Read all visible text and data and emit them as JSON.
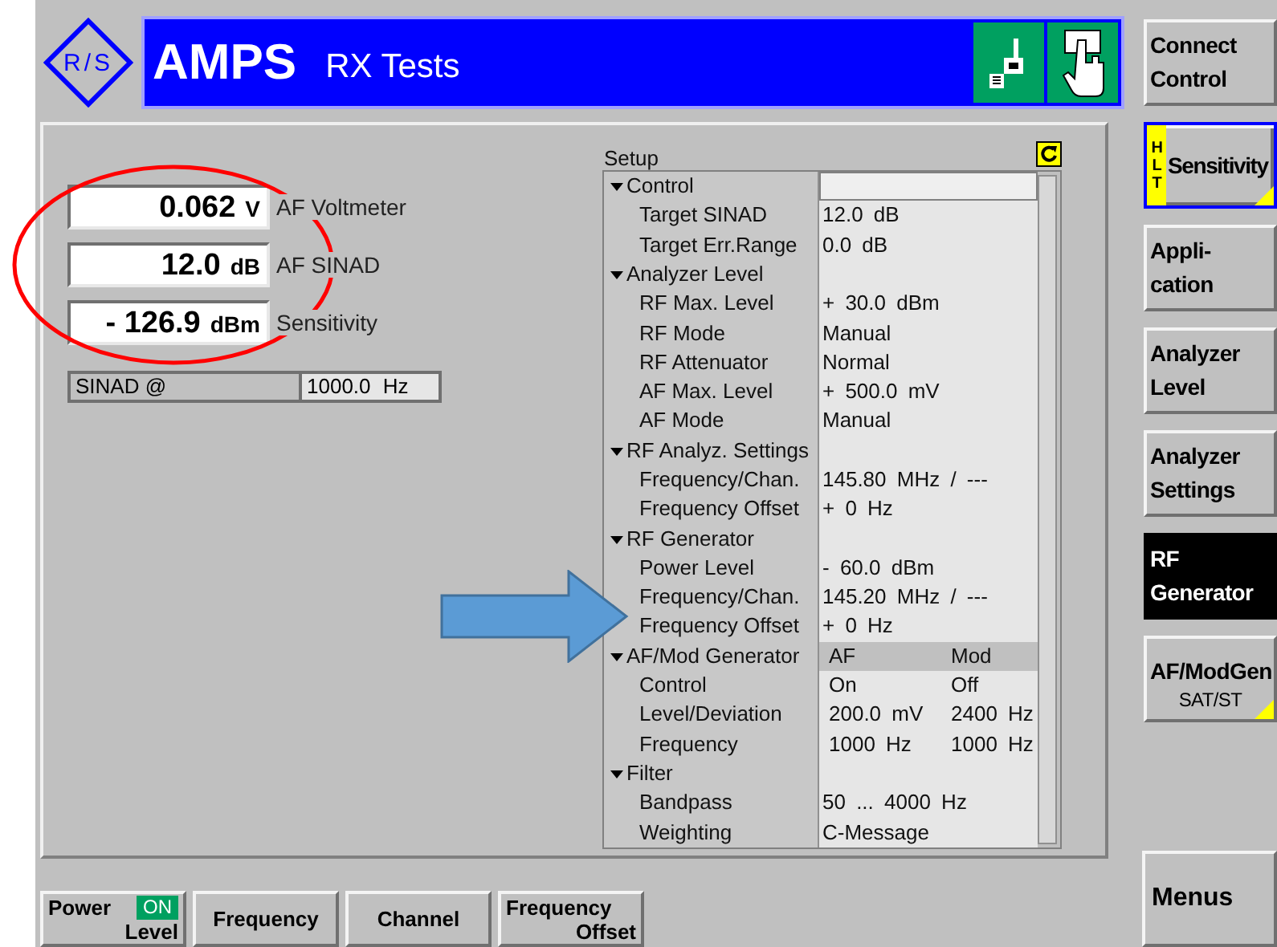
{
  "header": {
    "logo": "R/S",
    "title": "AMPS",
    "subtitle": "RX Tests"
  },
  "measurements": [
    {
      "value": "0.062",
      "unit": "V",
      "label": "AF Voltmeter"
    },
    {
      "value": "12.0",
      "unit": "dB",
      "label": "AF SINAD"
    },
    {
      "value": "- 126.9",
      "unit": "dBm",
      "label": "Sensitivity"
    }
  ],
  "sinad_at": {
    "label": "SINAD @",
    "value": "1000.0 Hz"
  },
  "setup": {
    "title": "Setup",
    "groups": [
      {
        "label": "Control",
        "expanded": true,
        "selected": true,
        "children": [
          {
            "label": "Target SINAD",
            "values": [
              "12.0 dB"
            ]
          },
          {
            "label": "Target Err.Range",
            "values": [
              "0.0 dB"
            ]
          }
        ]
      },
      {
        "label": "Analyzer Level",
        "expanded": true,
        "selected": false,
        "children": [
          {
            "label": "RF Max. Level",
            "values": [
              "+ 30.0 dBm"
            ]
          },
          {
            "label": "RF Mode",
            "values": [
              "Manual"
            ]
          },
          {
            "label": "RF Attenuator",
            "values": [
              "Normal"
            ]
          },
          {
            "label": "AF Max. Level",
            "values": [
              "+ 500.0 mV"
            ]
          },
          {
            "label": "AF Mode",
            "values": [
              "Manual"
            ]
          }
        ]
      },
      {
        "label": "RF Analyz. Settings",
        "expanded": true,
        "selected": false,
        "children": [
          {
            "label": "Frequency/Chan.",
            "values": [
              "145.80 MHz / ---"
            ]
          },
          {
            "label": "Frequency Offset",
            "values": [
              "+ 0 Hz"
            ]
          }
        ]
      },
      {
        "label": "RF Generator",
        "expanded": true,
        "selected": false,
        "children": [
          {
            "label": "Power Level",
            "values": [
              "- 60.0 dBm"
            ]
          },
          {
            "label": "Frequency/Chan.",
            "values": [
              "145.20 MHz / ---"
            ]
          },
          {
            "label": "Frequency Offset",
            "values": [
              "+ 0 Hz"
            ]
          }
        ]
      },
      {
        "label": "AF/Mod Generator",
        "expanded": true,
        "selected": false,
        "header_values": [
          "AF",
          "Mod"
        ],
        "children": [
          {
            "label": "Control",
            "values": [
              "On",
              "Off"
            ]
          },
          {
            "label": "Level/Deviation",
            "values": [
              "200.0 mV",
              "2400 Hz"
            ]
          },
          {
            "label": "Frequency",
            "values": [
              "1000 Hz",
              "1000 Hz"
            ]
          }
        ]
      },
      {
        "label": "Filter",
        "expanded": true,
        "selected": false,
        "children": [
          {
            "label": "Bandpass",
            "values": [
              "50 ... 4000 Hz"
            ]
          },
          {
            "label": "Weighting",
            "values": [
              "C-Message"
            ]
          }
        ]
      }
    ]
  },
  "softkeys": [
    {
      "label": "Connect\nControl",
      "selected": false,
      "focused": false,
      "corner_mark": false
    },
    {
      "label": "Sensitivity",
      "badge": "HLT",
      "selected": false,
      "focused": true,
      "corner_mark": true
    },
    {
      "label": "Appli-\ncation",
      "selected": false,
      "focused": false,
      "corner_mark": false
    },
    {
      "label": "Analyzer\nLevel",
      "selected": false,
      "focused": false,
      "corner_mark": false
    },
    {
      "label": "Analyzer\nSettings",
      "selected": false,
      "focused": false,
      "corner_mark": false
    },
    {
      "label": "RF\nGenerator",
      "selected": true,
      "focused": false,
      "corner_mark": false
    },
    {
      "label": "AF/ModGen",
      "sublabel": "SAT/ST",
      "selected": false,
      "focused": false,
      "corner_mark": true
    }
  ],
  "menus_key": {
    "label": "Menus"
  },
  "bottom_keys": [
    {
      "lines": [
        "Power",
        "Level"
      ],
      "status": "ON"
    },
    {
      "lines": [
        "Frequency"
      ]
    },
    {
      "lines": [
        "Channel"
      ]
    },
    {
      "lines": [
        "Frequency",
        "Offset"
      ]
    }
  ],
  "annotations": [
    {
      "kind": "ellipse"
    },
    {
      "kind": "arrow"
    }
  ]
}
